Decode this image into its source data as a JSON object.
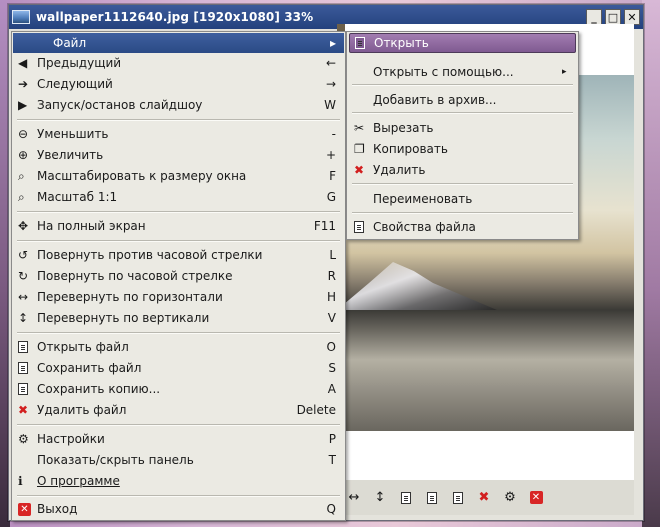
{
  "window": {
    "title": "wallpaper1112640.jpg [1920x1080] 33%",
    "controls": {
      "minimize": "_",
      "maximize": "□",
      "close": "✕"
    }
  },
  "menu": {
    "items": [
      {
        "label": "Файл",
        "shortcut": "",
        "icon": "",
        "arrow": "▸"
      },
      {
        "label": "Предыдущий",
        "shortcut": "←",
        "icon": "arrow-left-icon"
      },
      {
        "label": "Следующий",
        "shortcut": "→",
        "icon": "arrow-right-icon"
      },
      {
        "label": "Запуск/останов слайдшоу",
        "shortcut": "W",
        "icon": "play-icon"
      },
      {
        "label": "Уменьшить",
        "shortcut": "-",
        "icon": "zoom-out-icon"
      },
      {
        "label": "Увеличить",
        "shortcut": "+",
        "icon": "zoom-in-icon"
      },
      {
        "label": "Масштабировать к размеру окна",
        "shortcut": "F",
        "icon": "zoom-fit-icon"
      },
      {
        "label": "Масштаб 1:1",
        "shortcut": "G",
        "icon": "zoom-original-icon"
      },
      {
        "label": "На полный экран",
        "shortcut": "F11",
        "icon": "fullscreen-icon"
      },
      {
        "label": "Повернуть против часовой стрелки",
        "shortcut": "L",
        "icon": "rotate-ccw-icon"
      },
      {
        "label": "Повернуть по часовой стрелке",
        "shortcut": "R",
        "icon": "rotate-cw-icon"
      },
      {
        "label": "Перевернуть по горизонтали",
        "shortcut": "H",
        "icon": "flip-horizontal-icon"
      },
      {
        "label": "Перевернуть по вертикали",
        "shortcut": "V",
        "icon": "flip-vertical-icon"
      },
      {
        "label": "Открыть файл",
        "shortcut": "O",
        "icon": "open-file-icon"
      },
      {
        "label": "Сохранить файл",
        "shortcut": "S",
        "icon": "save-file-icon"
      },
      {
        "label": "Сохранить копию...",
        "shortcut": "A",
        "icon": "save-copy-icon"
      },
      {
        "label": "Удалить файл",
        "shortcut": "Delete",
        "icon": "delete-icon"
      },
      {
        "label": "Настройки",
        "shortcut": "P",
        "icon": "settings-icon"
      },
      {
        "label": "Показать/скрыть панель",
        "shortcut": "T",
        "icon": ""
      },
      {
        "label": "О программе",
        "shortcut": "",
        "icon": "info-icon"
      },
      {
        "label": "Выход",
        "shortcut": "Q",
        "icon": "exit-icon"
      }
    ]
  },
  "submenu": {
    "items": [
      {
        "label": "Открыть",
        "icon": "open-icon"
      },
      {
        "label": "Открыть с помощью...",
        "icon": "",
        "arrow": "▸"
      },
      {
        "label": "Добавить в архив...",
        "icon": ""
      },
      {
        "label": "Вырезать",
        "icon": "cut-icon"
      },
      {
        "label": "Копировать",
        "icon": "copy-icon"
      },
      {
        "label": "Удалить",
        "icon": "delete-icon"
      },
      {
        "label": "Переименовать",
        "icon": ""
      },
      {
        "label": "Свойства файла",
        "icon": "properties-icon"
      }
    ]
  },
  "toolbar": {
    "items": [
      "flip-horizontal-icon",
      "flip-vertical-icon",
      "open-file-icon",
      "save-file-icon",
      "save-copy-icon",
      "delete-icon",
      "settings-icon",
      "exit-icon"
    ]
  }
}
